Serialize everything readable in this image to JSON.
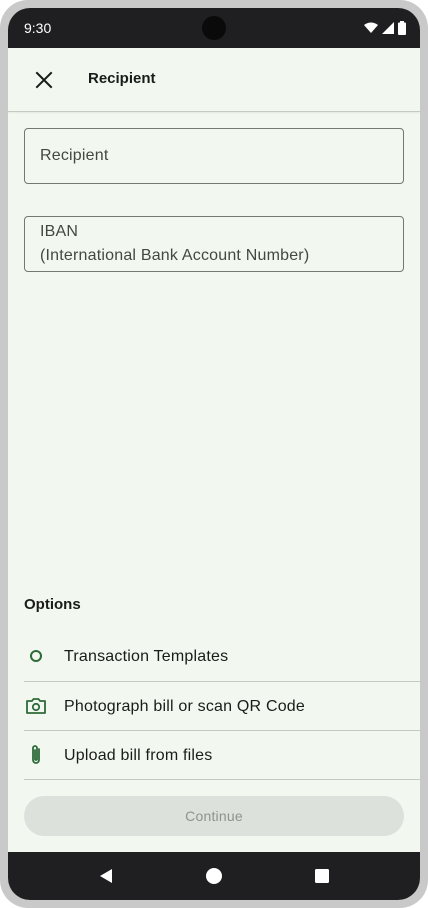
{
  "status_bar": {
    "time": "9:30",
    "icons": [
      "wifi-icon",
      "signal-icon",
      "battery-icon"
    ]
  },
  "app_bar": {
    "title": "Recipient",
    "close_icon": "close-icon"
  },
  "form": {
    "recipient_label": "Recipient",
    "iban_label_line1": "IBAN",
    "iban_label_line2": "(International Bank Account Number)"
  },
  "options": {
    "title": "Options",
    "items": [
      {
        "label": "Transaction Templates",
        "icon": "circle-outline-icon"
      },
      {
        "label": "Photograph bill or scan QR Code",
        "icon": "camera-icon"
      },
      {
        "label": "Upload bill from files",
        "icon": "paperclip-icon"
      }
    ]
  },
  "continue_button": {
    "label": "Continue",
    "enabled": false
  },
  "nav_bar": {
    "icons": [
      "back-icon",
      "home-icon",
      "recents-icon"
    ]
  },
  "colors": {
    "background": "#f2f8ef",
    "accent": "#2e6b3a",
    "system_bar": "#1f1e20",
    "disabled_button": "#dde1dc"
  }
}
